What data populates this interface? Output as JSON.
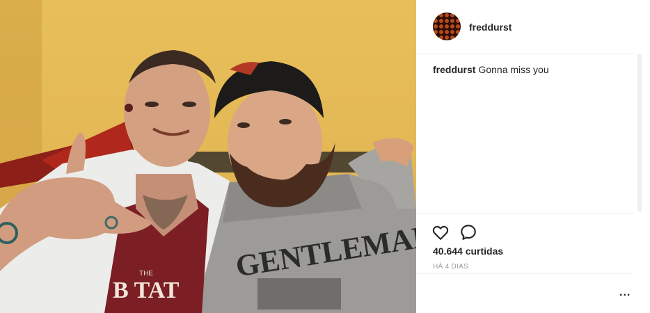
{
  "post": {
    "username": "freddurst",
    "caption_user": "freddurst",
    "caption_text": "Gonna miss you",
    "likes": "40.644 curtidas",
    "timestamp": "HÁ 4 DIAS",
    "more": "..."
  },
  "photo": {
    "shirt_text_left": "B TAT",
    "shirt_text_small": "THE",
    "sweater_text": "GENTLEMAN"
  },
  "icons": {
    "like": "heart-icon",
    "comment": "comment-icon",
    "more": "more-options-icon"
  },
  "colors": {
    "wall": "#e3b754",
    "avatar": "#7a2210"
  }
}
